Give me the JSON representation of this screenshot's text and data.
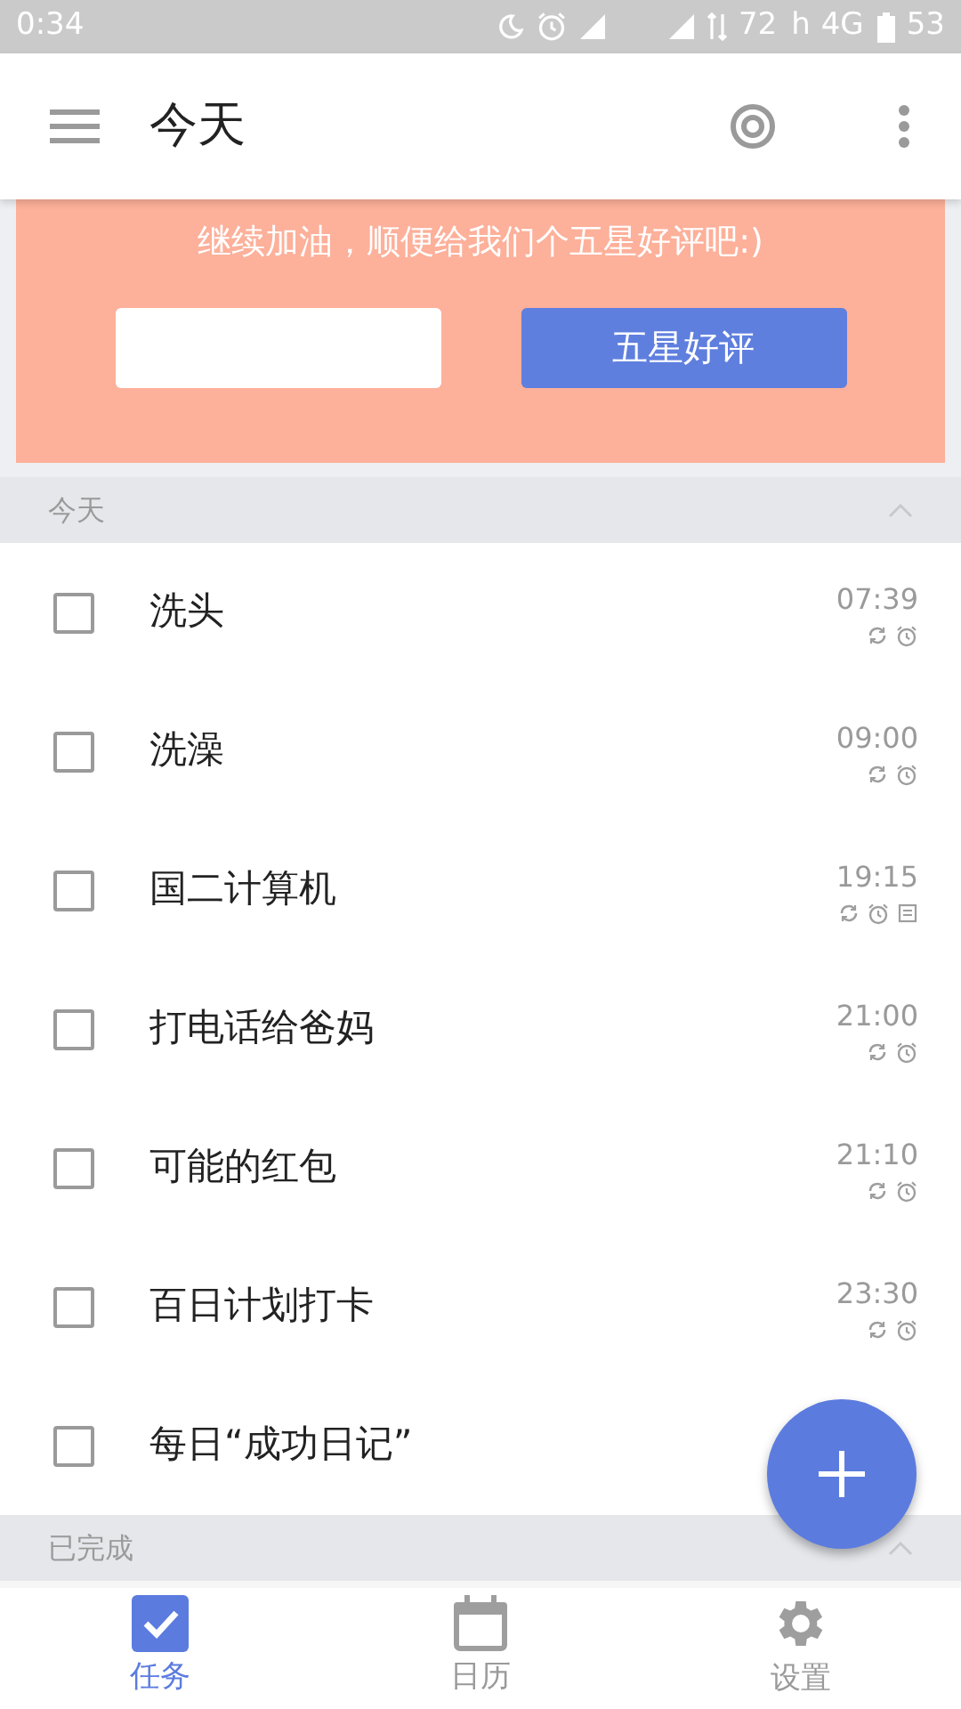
{
  "status_bar": {
    "time": "0:34",
    "network_speed": "72",
    "network_unit": "h",
    "network_type": "4G",
    "battery": "53"
  },
  "app_bar": {
    "title": "今天"
  },
  "banner": {
    "message": "继续加油，顺便给我们个五星好评吧:)",
    "button": "五星好评"
  },
  "sections": [
    {
      "title": "今天",
      "expanded": true,
      "tasks": [
        {
          "title": "洗头",
          "checked": false,
          "time": "07:39",
          "repeat": true,
          "alarm": true,
          "note": false
        },
        {
          "title": "洗澡",
          "checked": false,
          "time": "09:00",
          "repeat": true,
          "alarm": true,
          "note": false
        },
        {
          "title": "国二计算机",
          "checked": false,
          "time": "19:15",
          "repeat": true,
          "alarm": true,
          "note": true
        },
        {
          "title": "打电话给爸妈",
          "checked": false,
          "time": "21:00",
          "repeat": true,
          "alarm": true,
          "note": false
        },
        {
          "title": "可能的红包",
          "checked": false,
          "time": "21:10",
          "repeat": true,
          "alarm": true,
          "note": false
        },
        {
          "title": "百日计划打卡",
          "checked": false,
          "time": "23:30",
          "repeat": true,
          "alarm": true,
          "note": false
        },
        {
          "title": "每日“成功日记”",
          "checked": false
        }
      ]
    },
    {
      "title": "已完成",
      "expanded": true
    }
  ],
  "bottom_nav": [
    {
      "label": "任务",
      "kind": "tasks",
      "selected": true
    },
    {
      "label": "日历",
      "kind": "calendar",
      "selected": false
    },
    {
      "label": "设置",
      "kind": "settings",
      "selected": false
    }
  ]
}
